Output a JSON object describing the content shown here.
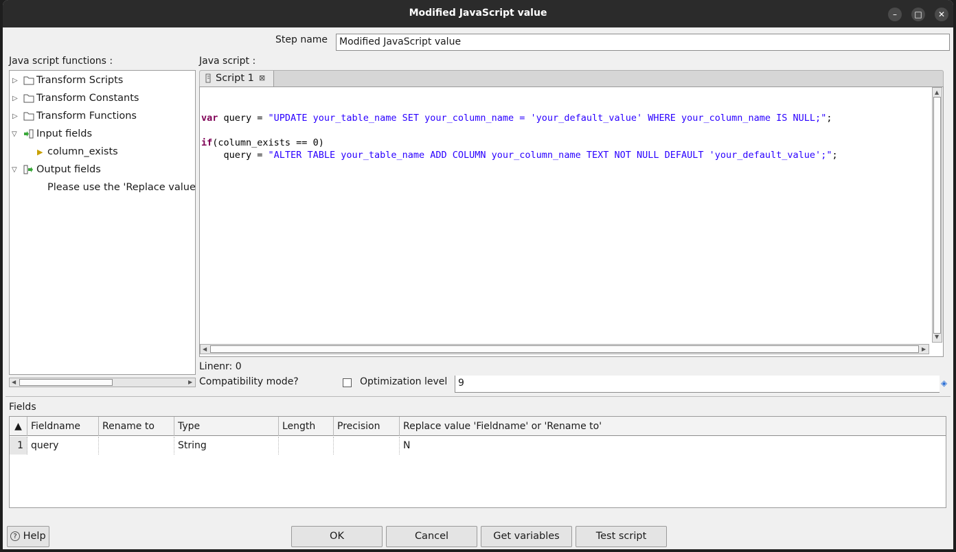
{
  "window": {
    "title": "Modified JavaScript value"
  },
  "step": {
    "label": "Step name",
    "value": "Modified JavaScript value"
  },
  "functions": {
    "label": "Java script functions :",
    "tree": [
      {
        "label": "Transform Scripts"
      },
      {
        "label": "Transform Constants"
      },
      {
        "label": "Transform Functions"
      },
      {
        "label": "Input fields",
        "children": [
          "column_exists"
        ]
      },
      {
        "label": "Output fields",
        "children": [
          "Please use the 'Replace value"
        ]
      }
    ]
  },
  "script": {
    "label": "Java script :",
    "tab_label": "Script 1",
    "lines": [
      "",
      "var query = \"UPDATE your_table_name SET your_column_name = 'your_default_value' WHERE your_column_name IS NULL;\";",
      "",
      "if(column_exists == 0)",
      "    query = \"ALTER TABLE your_table_name ADD COLUMN your_column_name TEXT NOT NULL DEFAULT 'your_default_value';\";"
    ],
    "linenr": "Linenr: 0"
  },
  "compat": {
    "label": "Compatibility mode?",
    "checked": false
  },
  "optimization": {
    "label": "Optimization level",
    "value": "9"
  },
  "fields": {
    "label": "Fields",
    "columns": [
      "Fieldname",
      "Rename to",
      "Type",
      "Length",
      "Precision",
      "Replace value 'Fieldname' or 'Rename to'"
    ],
    "rows": [
      {
        "num": "1",
        "cells": [
          "query",
          "",
          "String",
          "",
          "",
          "N"
        ]
      }
    ]
  },
  "buttons": {
    "help": "Help",
    "ok": "OK",
    "cancel": "Cancel",
    "get_variables": "Get variables",
    "test_script": "Test script"
  },
  "colors": {
    "titlebar": "#2b2b2b",
    "keyword": "#7f0055",
    "string": "#2a00ff",
    "folder_arrow": "#c8a000"
  }
}
